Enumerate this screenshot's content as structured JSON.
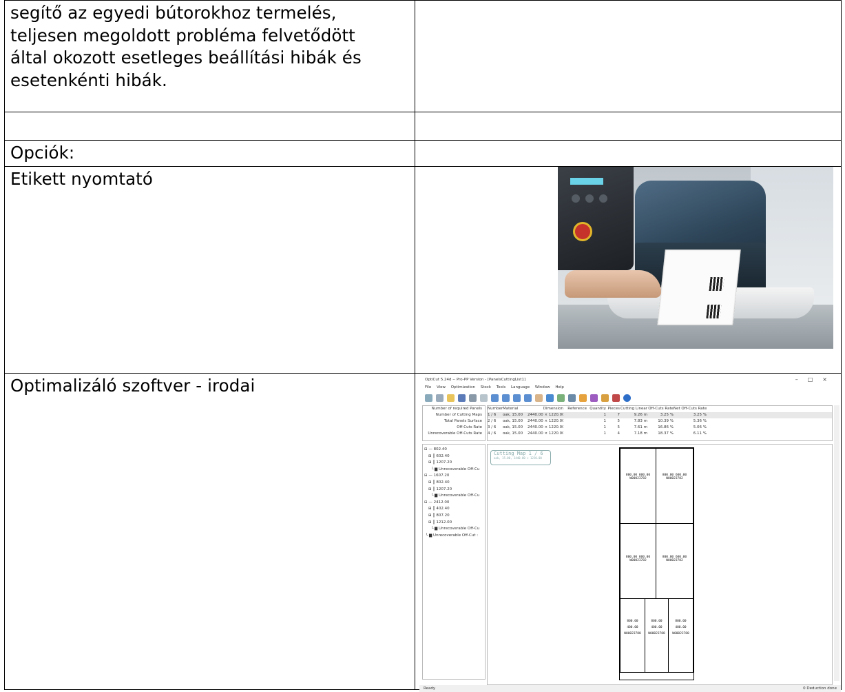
{
  "rows": [
    {
      "left_lines": [
        "segítő az egyedi bútorokhoz termelés,",
        "teljesen megoldott probléma felvetődött",
        "által okozott esetleges beállítási hibák és",
        "esetenkénti hibák."
      ],
      "right": ""
    },
    {
      "left": "",
      "right": ""
    },
    {
      "left": "Opciók:",
      "right": ""
    },
    {
      "left": "Etikett nyomtató",
      "right": "label-printer-photo"
    },
    {
      "left": "Optimalizáló szoftver - irodai",
      "right": "optimization-software-screenshot"
    }
  ],
  "software": {
    "title": "OptiCut 5.24d -- Pro-PP Version - [PanelsCuttingList1]",
    "menu": [
      "File",
      "View",
      "Optimization",
      "Stock",
      "Tools",
      "Language",
      "Window",
      "Help"
    ],
    "summary_labels": [
      "Number of required Panels",
      "Number of Cutting Maps",
      "Total Panels Surface",
      "Off-Cuts Rate",
      "Unrecoverable Off-Cuts Rate"
    ],
    "grid_headers": [
      "Number",
      "Material",
      "Dimension",
      "Reference",
      "Quantity",
      "Pieces",
      "Cutting Linear",
      "Off-Cuts Rate",
      "Net Off-Cuts Rate"
    ],
    "grid_rows": [
      [
        "1 / 6",
        "oak, 15.00",
        "2440.00 × 1220.00",
        "",
        "1",
        "7",
        "9.26 m",
        "3.25 %",
        "3.25 %"
      ],
      [
        "2 / 6",
        "oak, 15.00",
        "2440.00 × 1220.00",
        "",
        "1",
        "5",
        "7.83 m",
        "10.39 %",
        "5.36 %"
      ],
      [
        "3 / 6",
        "oak, 15.00",
        "2440.00 × 1220.00",
        "",
        "1",
        "5",
        "7.61 m",
        "16.86 %",
        "5.06 %"
      ],
      [
        "4 / 6",
        "oak, 15.00",
        "2440.00 × 1220.00",
        "",
        "1",
        "4",
        "7.18 m",
        "18.37 %",
        "6.11 %"
      ]
    ],
    "tree": [
      "802.40",
      "602.40",
      "1207.20",
      "Unrecoverable Off-Cu",
      "1607.20",
      "802.40",
      "1207.20",
      "Unrecoverable Off-Cu",
      "2412.00",
      "402.40",
      "807.20",
      "1212.00",
      "Unrecoverable Off-Cu",
      "Unrecoverable Off-Cut :"
    ],
    "map_title": "Cutting Map 1 / 6",
    "map_subtitle": "oak, 15.00, 2440.00 × 1220.00",
    "pieces": {
      "p1_dims": "800.00    600.00",
      "p1_ref": "W00023782",
      "p2_dims": "800.00    600.00",
      "p2_ref": "W00023782",
      "p3_dims": "800.00    600.00",
      "p3_ref": "W00023782",
      "p4_dims": "800.00    600.00",
      "p4_ref": "W00023782",
      "p5_w": "800.00",
      "p5_h": "400.00",
      "p5_ref": "W00023780",
      "p6_w": "800.00",
      "p6_h": "400.00",
      "p6_ref": "W00023788",
      "p7_w": "800.00",
      "p7_h": "400.00",
      "p7_ref": "W00023780"
    },
    "status_left": "Ready",
    "status_right": "0 Deduction done"
  }
}
